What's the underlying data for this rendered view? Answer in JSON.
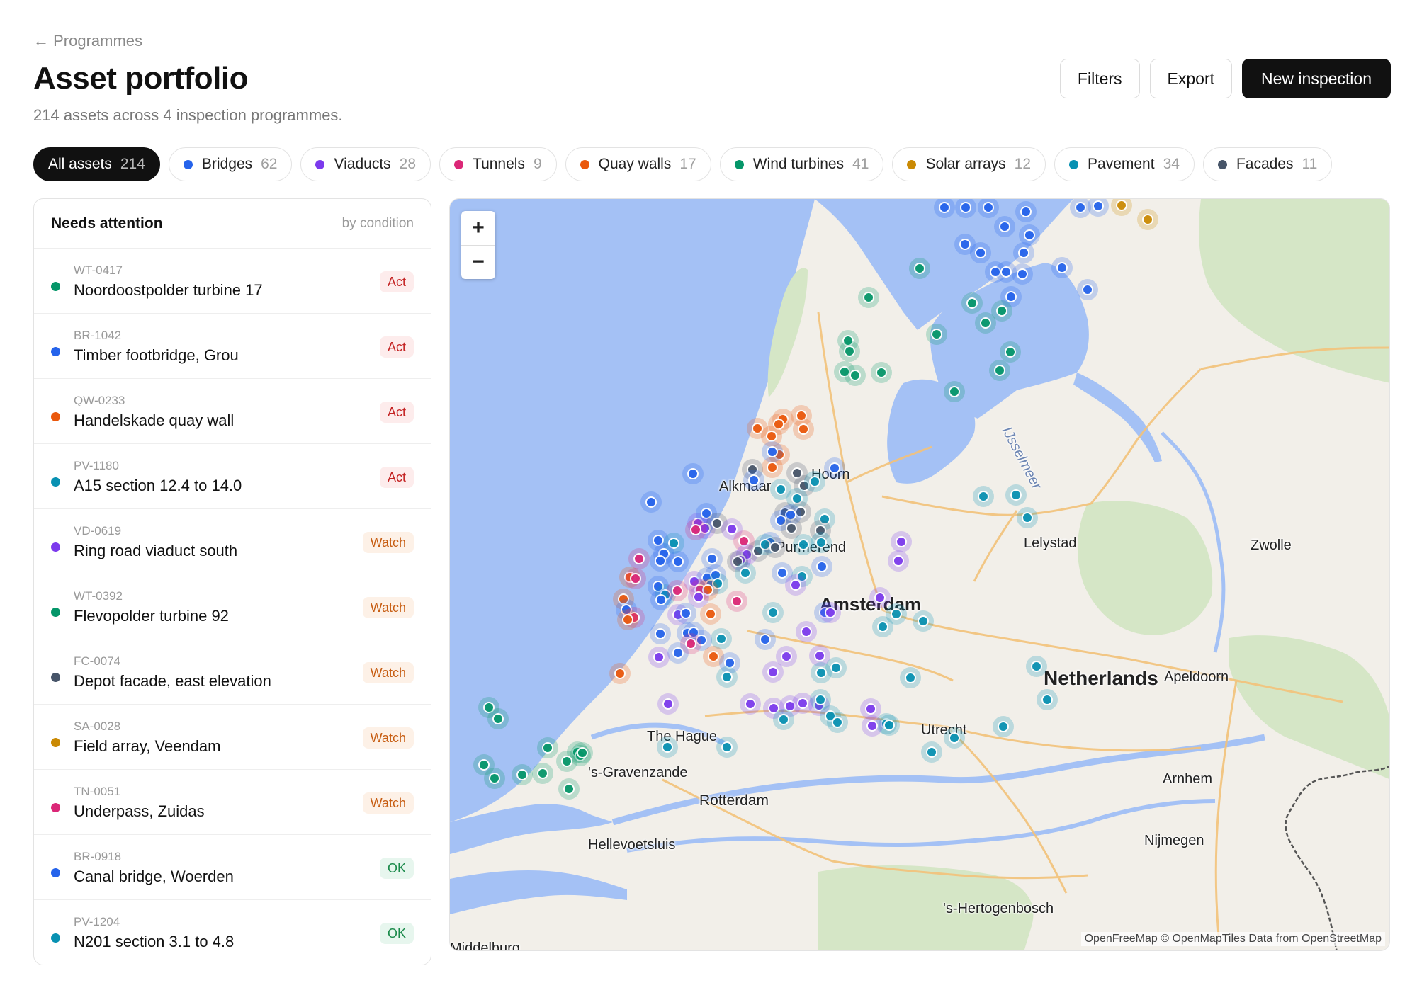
{
  "header": {
    "back_label": "← Programmes",
    "title": "Asset portfolio",
    "subtitle": "214 assets across 4 inspection programmes."
  },
  "actions": {
    "filters_label": "Filters",
    "export_label": "Export",
    "new_label": "New inspection"
  },
  "chips": [
    {
      "label": "All assets",
      "count": "214",
      "color": "",
      "active": true
    },
    {
      "label": "Bridges",
      "count": "62",
      "color": "#2563eb"
    },
    {
      "label": "Viaducts",
      "count": "28",
      "color": "#7c3aed"
    },
    {
      "label": "Tunnels",
      "count": "9",
      "color": "#db2777"
    },
    {
      "label": "Quay walls",
      "count": "17",
      "color": "#ea580c"
    },
    {
      "label": "Wind turbines",
      "count": "41",
      "color": "#059669"
    },
    {
      "label": "Solar arrays",
      "count": "12",
      "color": "#ca8a04"
    },
    {
      "label": "Pavement",
      "count": "34",
      "color": "#0891b2"
    },
    {
      "label": "Facades",
      "count": "11",
      "color": "#475569"
    }
  ],
  "panel": {
    "title": "Needs attention",
    "sort_label": "by condition",
    "items": [
      {
        "id": "WT-0417",
        "name": "Noordoostpolder turbine 17",
        "status": "Act",
        "color": "#059669"
      },
      {
        "id": "BR-1042",
        "name": "Timber footbridge, Grou",
        "status": "Act",
        "color": "#2563eb"
      },
      {
        "id": "QW-0233",
        "name": "Handelskade quay wall",
        "status": "Act",
        "color": "#ea580c"
      },
      {
        "id": "PV-1180",
        "name": "A15 section 12.4 to 14.0",
        "status": "Act",
        "color": "#0891b2"
      },
      {
        "id": "VD-0619",
        "name": "Ring road viaduct south",
        "status": "Watch",
        "color": "#7c3aed"
      },
      {
        "id": "WT-0392",
        "name": "Flevopolder turbine 92",
        "status": "Watch",
        "color": "#059669"
      },
      {
        "id": "FC-0074",
        "name": "Depot facade, east elevation",
        "status": "Watch",
        "color": "#475569"
      },
      {
        "id": "SA-0028",
        "name": "Field array, Veendam",
        "status": "Watch",
        "color": "#ca8a04"
      },
      {
        "id": "TN-0051",
        "name": "Underpass, Zuidas",
        "status": "Watch",
        "color": "#db2777"
      },
      {
        "id": "BR-0918",
        "name": "Canal bridge, Woerden",
        "status": "OK",
        "color": "#2563eb"
      },
      {
        "id": "PV-1204",
        "name": "N201 section 3.1 to 4.8",
        "status": "OK",
        "color": "#0891b2"
      }
    ]
  },
  "map": {
    "zoom_in": "+",
    "zoom_out": "−",
    "attribution": "OpenFreeMap © OpenMapTiles Data from OpenStreetMap",
    "places": [
      "Alkmaar",
      "Hoorn",
      "Purmerend",
      "Lelystad",
      "Zwolle",
      "Amsterdam",
      "Netherlands",
      "Apeldoorn",
      "Utrecht",
      "The Hague",
      "'s-Gravenzande",
      "Rotterdam",
      "Arnhem",
      "Hellevoetsluis",
      "Nijmegen",
      "'s-Hertogenbosch",
      "Middelburg",
      "IJsselmeer"
    ],
    "colors": {
      "water": "#a4c1f5",
      "land": "#f2efe9",
      "green": "#d5e6c6",
      "road": "#f3c27a",
      "border": "#555555"
    }
  }
}
